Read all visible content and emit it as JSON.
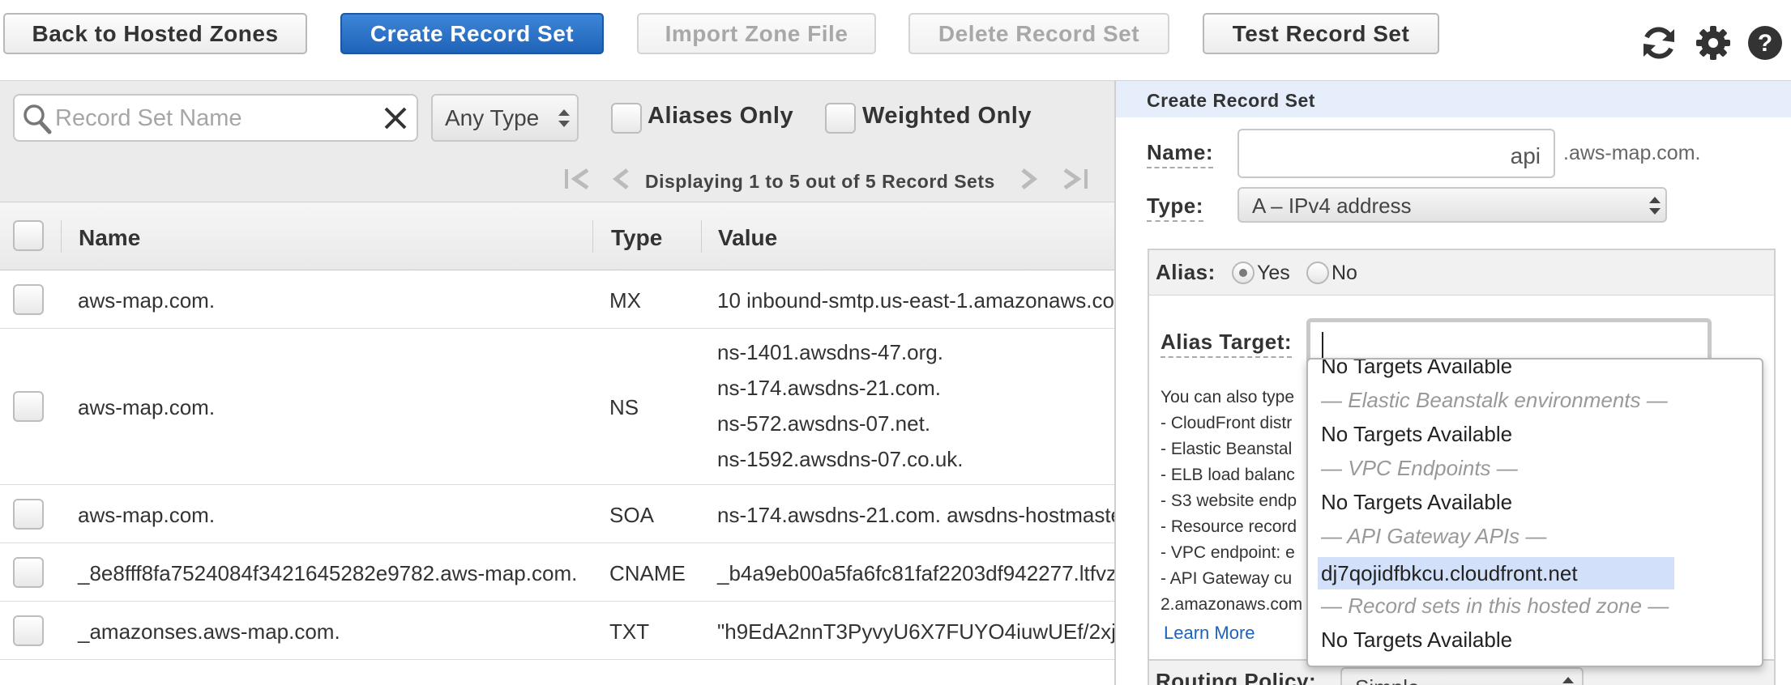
{
  "toolbar": {
    "back": "Back to Hosted Zones",
    "create": "Create Record Set",
    "import": "Import Zone File",
    "delete": "Delete Record Set",
    "test": "Test Record Set"
  },
  "filter": {
    "search_placeholder": "Record Set Name",
    "type_select": "Any Type",
    "aliases_only": "Aliases Only",
    "weighted_only": "Weighted Only",
    "pager_text": "Displaying 1 to 5 out of 5 Record Sets"
  },
  "table": {
    "headers": {
      "name": "Name",
      "type": "Type",
      "value": "Value"
    },
    "rows": [
      {
        "name": "aws-map.com.",
        "type": "MX",
        "value": [
          "10 inbound-smtp.us-east-1.amazonaws.co"
        ]
      },
      {
        "name": "aws-map.com.",
        "type": "NS",
        "value": [
          "ns-1401.awsdns-47.org.",
          "ns-174.awsdns-21.com.",
          "ns-572.awsdns-07.net.",
          "ns-1592.awsdns-07.co.uk."
        ]
      },
      {
        "name": "aws-map.com.",
        "type": "SOA",
        "value": [
          "ns-174.awsdns-21.com. awsdns-hostmaste"
        ]
      },
      {
        "name": "_8e8fff8fa7524084f3421645282e9782.aws-map.com.",
        "type": "CNAME",
        "value": [
          "_b4a9eb00a5fa6fc81faf2203df942277.ltfvz"
        ]
      },
      {
        "name": "_amazonses.aws-map.com.",
        "type": "TXT",
        "value": [
          "\"h9EdA2nnT3PyvyU6X7FUYO4iuwUEf/2xj\""
        ]
      }
    ]
  },
  "panel": {
    "title": "Create Record Set",
    "name_label": "Name:",
    "name_value": "api",
    "domain_suffix": ".aws-map.com.",
    "type_label": "Type:",
    "type_value": "A – IPv4 address",
    "alias_label": "Alias:",
    "alias_yes": "Yes",
    "alias_no": "No",
    "alias_selected": "Yes",
    "alias_target_label": "Alias Target:",
    "alias_target_value": "",
    "description_lines": [
      "You can also type",
      "-  CloudFront distr",
      "-  Elastic Beanstal",
      "-  ELB load balanc",
      "-  S3 website endp",
      "-  Resource record",
      "-  VPC endpoint: e",
      "-  API Gateway cu",
      "2.amazonaws.com"
    ],
    "learn_more": "Learn More",
    "routing_label": "Routing Policy:",
    "routing_value": "Simple"
  },
  "dropdown": {
    "items": [
      {
        "text": "No Targets Available",
        "kind": "item"
      },
      {
        "text": "— Elastic Beanstalk environments —",
        "kind": "group"
      },
      {
        "text": "No Targets Available",
        "kind": "item"
      },
      {
        "text": "— VPC Endpoints —",
        "kind": "group"
      },
      {
        "text": "No Targets Available",
        "kind": "item"
      },
      {
        "text": "— API Gateway APIs —",
        "kind": "group"
      },
      {
        "text": "dj7qojidfbkcu.cloudfront.net",
        "kind": "selected"
      },
      {
        "text": "— Record sets in this hosted zone —",
        "kind": "group"
      },
      {
        "text": "No Targets Available",
        "kind": "item"
      }
    ]
  },
  "colors": {
    "primary_button": "#2a6fc9",
    "panel_header": "#e6eefb",
    "dropdown_selected": "#d2e0fa",
    "link": "#1f63b8"
  },
  "icons": [
    "refresh-icon",
    "gear-icon",
    "help-icon",
    "search-icon",
    "clear-icon",
    "first-page-icon",
    "prev-page-icon",
    "next-page-icon",
    "last-page-icon"
  ]
}
